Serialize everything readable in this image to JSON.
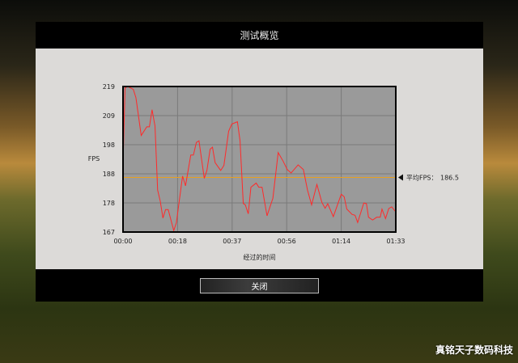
{
  "dialog": {
    "title": "测试概览",
    "close_label": "关闭"
  },
  "watermark": "真铭天子数码科技",
  "chart_data": {
    "type": "line",
    "title": "",
    "xlabel": "经过的时间",
    "ylabel": "FPS",
    "ylim": [
      167,
      219
    ],
    "xlim": [
      0,
      93
    ],
    "yticks": [
      "219",
      "209",
      "198",
      "188",
      "178",
      "167"
    ],
    "xticks": [
      "00:00",
      "00:18",
      "00:37",
      "00:56",
      "01:14",
      "01:33"
    ],
    "average": {
      "label": "平均FPS：",
      "value": "186.5",
      "fps": 186.5,
      "color": "#e8a020"
    },
    "series": [
      {
        "name": "FPS",
        "color": "#ff2a2a",
        "x": [
          0,
          0.3,
          0.7,
          1.6,
          3.5,
          4.4,
          6.2,
          8.1,
          9,
          9.9,
          10.9,
          11.8,
          12.7,
          13.6,
          14.5,
          15.4,
          17.3,
          18.2,
          20.3,
          21.3,
          23.1,
          24,
          25,
          25.9,
          27.7,
          28.6,
          29.7,
          30.5,
          31.4,
          33.3,
          34.4,
          36,
          37.1,
          39,
          39.9,
          41,
          41.7,
          42.7,
          43.6,
          45.4,
          46.3,
          47.4,
          49.1,
          51.1,
          52.9,
          54.6,
          56,
          57.3,
          59.7,
          61.5,
          62.9,
          64.3,
          66.1,
          67.8,
          68.9,
          69.8,
          71.7,
          74.4,
          75.4,
          76.3,
          78.1,
          79.1,
          80,
          82.1,
          83,
          83.7,
          85.1,
          86.5,
          87.7,
          88.3,
          89.5,
          90.6,
          91.6,
          93
        ],
        "y": [
          190.8,
          203,
          218.5,
          219,
          218,
          215,
          201.5,
          204.6,
          204.6,
          210.7,
          204.9,
          182,
          178,
          172,
          175,
          175,
          167.5,
          170.4,
          187,
          183.5,
          194.5,
          194.5,
          199,
          199.6,
          186.2,
          189,
          196.6,
          197.3,
          191.8,
          189,
          190.8,
          203,
          205.6,
          206.4,
          199.6,
          177.2,
          176.7,
          173.5,
          183,
          184.5,
          183,
          183,
          172.8,
          179.1,
          195.4,
          192.3,
          189.3,
          188.1,
          191,
          189.3,
          182,
          176.7,
          184,
          177.6,
          175.5,
          177.1,
          172.5,
          180.5,
          179.6,
          175.2,
          173.3,
          173,
          170.4,
          177.4,
          177.1,
          172.3,
          171.3,
          172.3,
          172.3,
          175.2,
          171.8,
          175.4,
          176,
          174.2
        ]
      }
    ]
  }
}
